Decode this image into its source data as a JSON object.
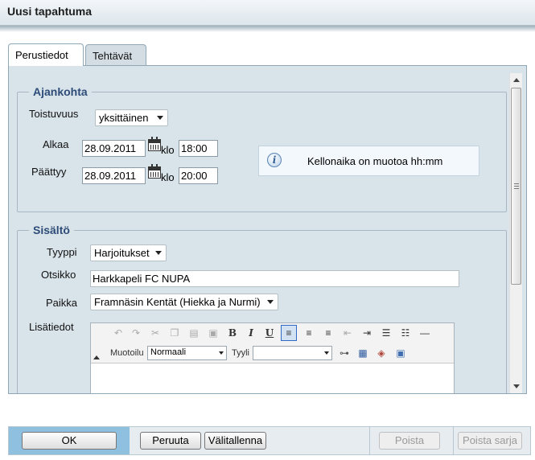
{
  "window": {
    "title": "Uusi tapahtuma"
  },
  "tabs": [
    {
      "label": "Perustiedot",
      "active": true
    },
    {
      "label": "Tehtävät",
      "active": false
    }
  ],
  "ajankohta": {
    "legend": "Ajankohta",
    "toistuvuus_label": "Toistuvuus",
    "toistuvuus_value": "yksittäinen",
    "alkaa_label": "Alkaa",
    "alkaa_date": "28.09.2011",
    "alkaa_time": "18:00",
    "paattyy_label": "Päättyy",
    "paattyy_date": "28.09.2011",
    "paattyy_time": "20:00",
    "klo_label": "klo",
    "info_text": "Kellonaika on muotoa hh:mm"
  },
  "sisalto": {
    "legend": "Sisältö",
    "tyyppi_label": "Tyyppi",
    "tyyppi_value": "Harjoitukset",
    "otsikko_label": "Otsikko",
    "otsikko_value": "Harkkapeli FC NUPA",
    "paikka_label": "Paikka",
    "paikka_value": "Framnäsin Kentät (Hiekka ja Nurmi)",
    "lisatiedot_label": "Lisätiedot"
  },
  "editor": {
    "muotoilu_label": "Muotoilu",
    "muotoilu_value": "Normaali",
    "tyyli_label": "Tyyli",
    "tyyli_value": ""
  },
  "footer": {
    "ok": "OK",
    "cancel": "Peruuta",
    "save_draft": "Välitallenna",
    "delete": "Poista",
    "delete_series": "Poista sarja"
  },
  "colors": {
    "legend": "#2d4c77",
    "panel_bg": "#d9e3ea",
    "ok_area": "#8fc0df"
  }
}
